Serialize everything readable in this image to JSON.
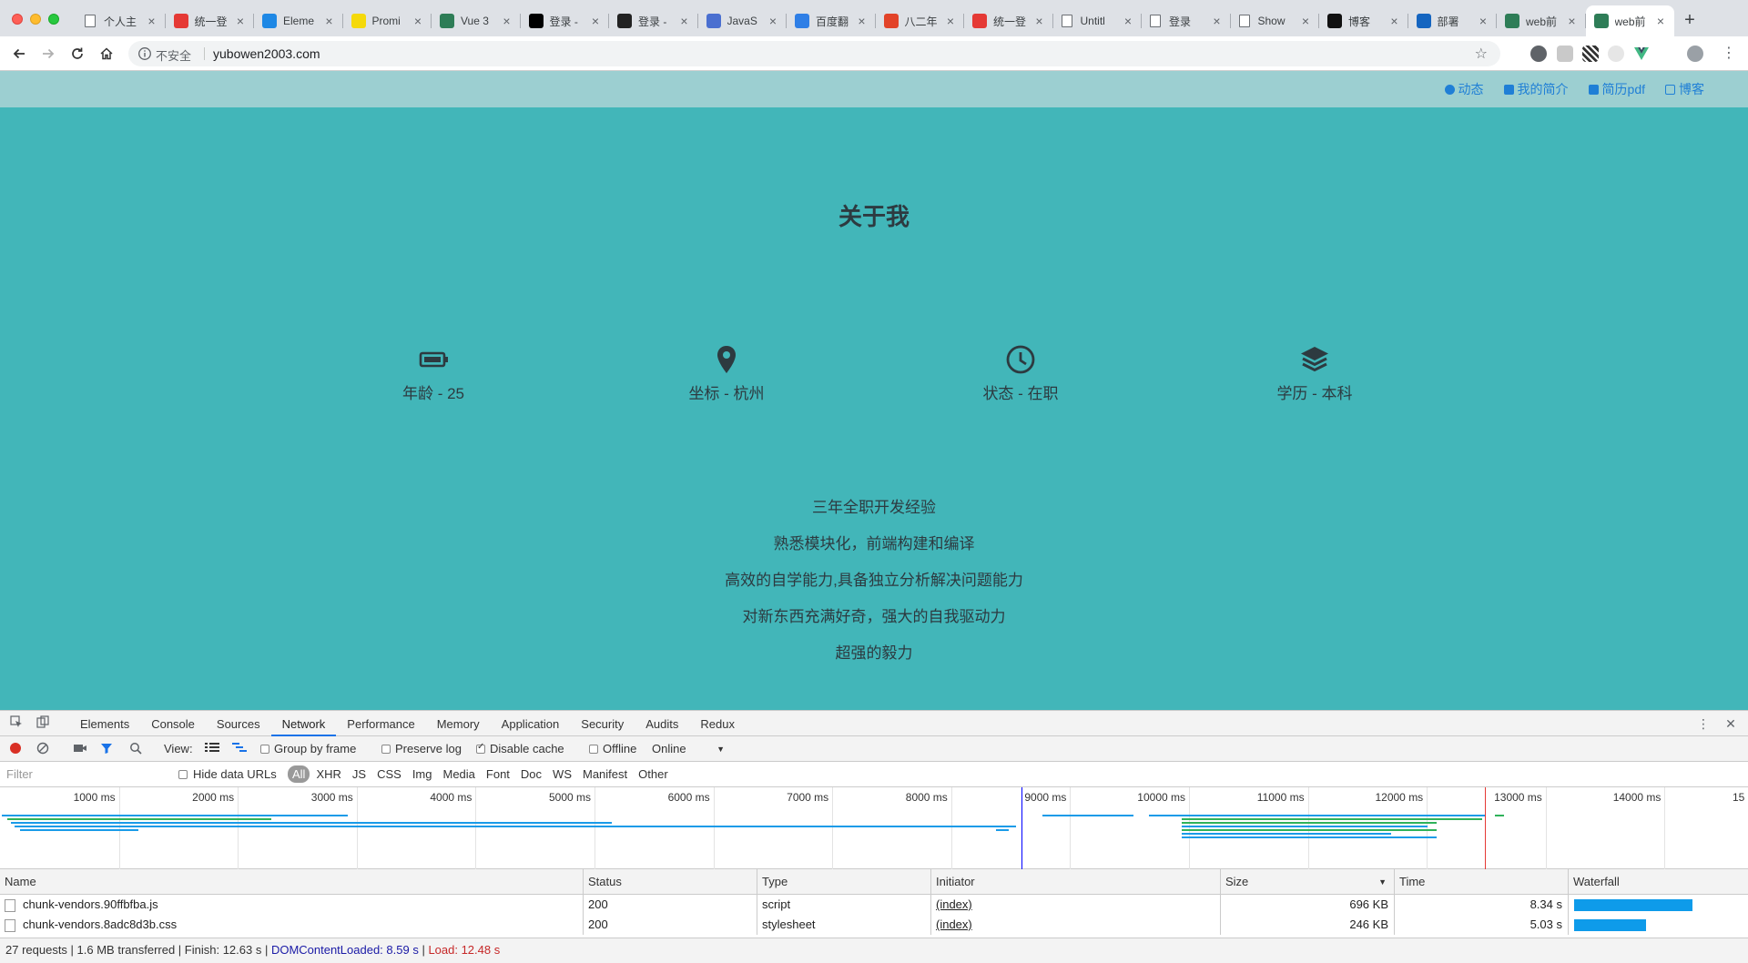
{
  "browser": {
    "tabs": [
      {
        "title": "个人主",
        "favicon": "doc-icon",
        "color": "#ffffff"
      },
      {
        "title": "统一登",
        "favicon": "login-icon",
        "color": "#e53935"
      },
      {
        "title": "Eleme",
        "favicon": "element-icon",
        "color": "#1e88e5"
      },
      {
        "title": "Promi",
        "favicon": "es-icon",
        "color": "#f5d90a"
      },
      {
        "title": "Vue 3",
        "favicon": "vue-icon",
        "color": "#2e7d57"
      },
      {
        "title": "登录 -",
        "favicon": "github-icon",
        "color": "#000000"
      },
      {
        "title": "登录 -",
        "favicon": "t-icon",
        "color": "#222222"
      },
      {
        "title": "JavaS",
        "favicon": "code-icon",
        "color": "#4a6fd0"
      },
      {
        "title": "百度翻",
        "favicon": "translate-icon",
        "color": "#2f7fe6"
      },
      {
        "title": "八二年",
        "favicon": "gitlab-icon",
        "color": "#e24329"
      },
      {
        "title": "统一登",
        "favicon": "login-icon",
        "color": "#e53935"
      },
      {
        "title": "Untitl",
        "favicon": "doc-icon",
        "color": "#ffffff"
      },
      {
        "title": "登录",
        "favicon": "doc-icon",
        "color": "#ffffff"
      },
      {
        "title": "Show",
        "favicon": "doc-icon",
        "color": "#ffffff"
      },
      {
        "title": "博客",
        "favicon": "n-icon",
        "color": "#111111"
      },
      {
        "title": "部署",
        "favicon": "h-icon",
        "color": "#1565c0"
      },
      {
        "title": "web前",
        "favicon": "vue-icon",
        "color": "#2e7d57"
      },
      {
        "title": "web前",
        "favicon": "vue-icon",
        "color": "#2e7d57",
        "active": true
      }
    ],
    "new_tab": "+",
    "insecure_label": "不安全",
    "url": "yubowen2003.com"
  },
  "site": {
    "nav": [
      {
        "label": "动态",
        "icon": "activity-icon"
      },
      {
        "label": "我的简介",
        "icon": "profile-icon"
      },
      {
        "label": "简历pdf",
        "icon": "pdf-icon"
      },
      {
        "label": "博客",
        "icon": "blog-icon"
      }
    ],
    "title": "关于我",
    "facts": [
      {
        "label": "年龄 - 25",
        "icon": "battery-icon"
      },
      {
        "label": "坐标 - 杭州",
        "icon": "location-pin-icon"
      },
      {
        "label": "状态 - 在职",
        "icon": "clock-icon"
      },
      {
        "label": "学历 - 本科",
        "icon": "layers-icon"
      }
    ],
    "skills": [
      "三年全职开发经验",
      "熟悉模块化，前端构建和编译",
      "高效的自学能力,具备独立分析解决问题能力",
      "对新东西充满好奇，强大的自我驱动力",
      "超强的毅力"
    ]
  },
  "devtools": {
    "tabs": [
      "Elements",
      "Console",
      "Sources",
      "Network",
      "Performance",
      "Memory",
      "Application",
      "Security",
      "Audits",
      "Redux"
    ],
    "active_tab": "Network",
    "toolbar": {
      "view_label": "View:",
      "group_by_frame": "Group by frame",
      "preserve_log": "Preserve log",
      "disable_cache": "Disable cache",
      "offline": "Offline",
      "throttle": "Online"
    },
    "filter": {
      "placeholder": "Filter",
      "hide_data_urls": "Hide data URLs",
      "types": [
        "All",
        "XHR",
        "JS",
        "CSS",
        "Img",
        "Media",
        "Font",
        "Doc",
        "WS",
        "Manifest",
        "Other"
      ]
    },
    "timeline_ticks": [
      "1000 ms",
      "2000 ms",
      "3000 ms",
      "4000 ms",
      "5000 ms",
      "6000 ms",
      "7000 ms",
      "8000 ms",
      "9000 ms",
      "10000 ms",
      "11000 ms",
      "12000 ms",
      "13000 ms",
      "14000 ms",
      "15"
    ],
    "columns": [
      "Name",
      "Status",
      "Type",
      "Initiator",
      "Size",
      "Time",
      "Waterfall"
    ],
    "rows": [
      {
        "name": "chunk-vendors.90ffbfba.js",
        "status": "200",
        "type": "script",
        "initiator": "(index)",
        "size": "696 KB",
        "time": "8.34 s"
      },
      {
        "name": "chunk-vendors.8adc8d3b.css",
        "status": "200",
        "type": "stylesheet",
        "initiator": "(index)",
        "size": "246 KB",
        "time": "5.03 s"
      }
    ],
    "status": {
      "summary": "27 requests | 1.6 MB transferred | Finish: 12.63 s | ",
      "dom_content_loaded": "DOMContentLoaded: 8.59 s",
      "divider": " | ",
      "load": "Load: 12.48 s"
    },
    "colors": {
      "accent": "#1a73e8",
      "dom_line": "#0000ff",
      "load_line": "#e53935"
    }
  }
}
